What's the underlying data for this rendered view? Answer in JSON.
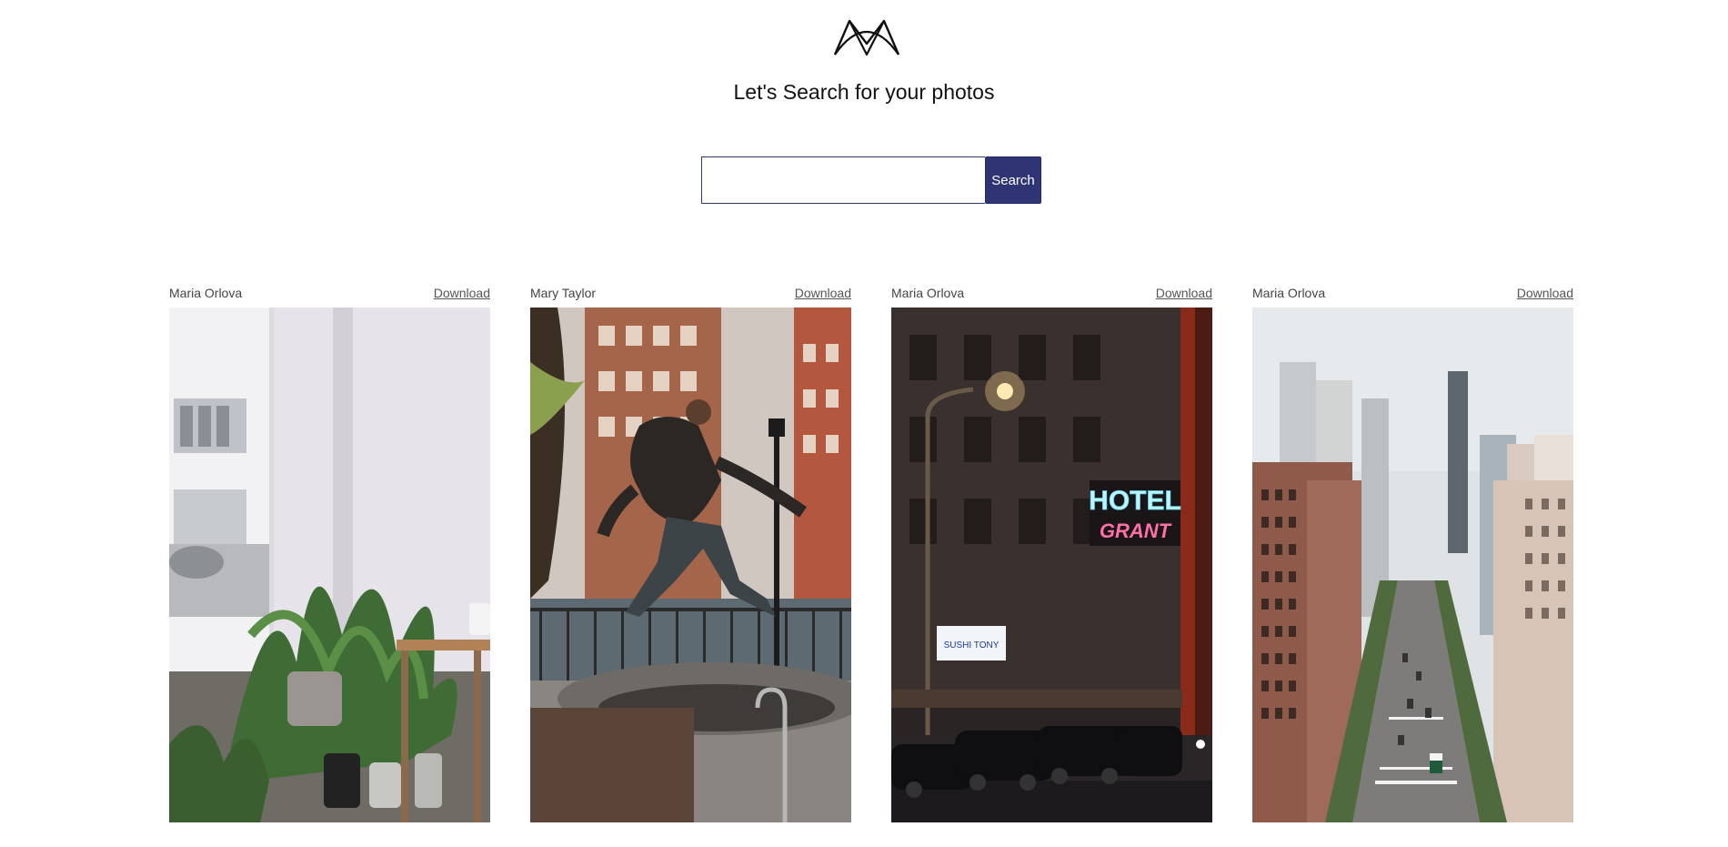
{
  "header": {
    "logo_icon": "mm-logo-icon",
    "title": "Let's Search for your photos"
  },
  "search": {
    "value": "",
    "placeholder": "",
    "button_label": "Search",
    "button_color": "#2f3475"
  },
  "photos": [
    {
      "author": "Maria Orlova",
      "download_label": "Download",
      "subject": "plants-by-window"
    },
    {
      "author": "Mary Taylor",
      "download_label": "Download",
      "subject": "man-jumping-street"
    },
    {
      "author": "Maria Orlova",
      "download_label": "Download",
      "subject": "hotel-grant-night"
    },
    {
      "author": "Maria Orlova",
      "download_label": "Download",
      "subject": "city-avenue-aerial"
    }
  ]
}
